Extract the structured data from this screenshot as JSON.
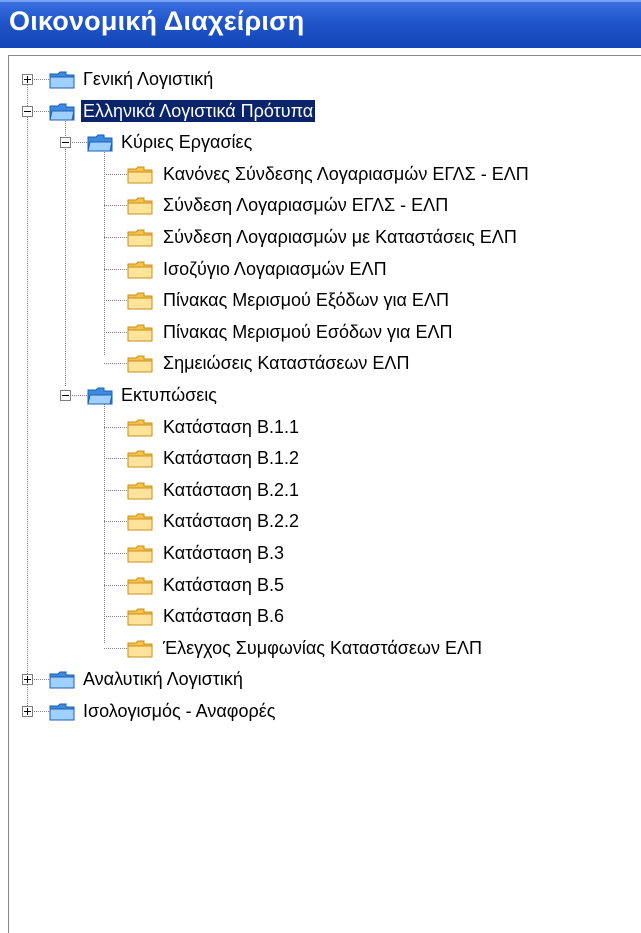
{
  "window": {
    "title": "Οικονομική Διαχείριση"
  },
  "colors": {
    "title_bar": "#1f54c8",
    "title_text": "#ffffff",
    "selection": "#0a246a",
    "folder_blue": "#3d8be0",
    "folder_yellow": "#f6c24a"
  },
  "tree": {
    "nodes": [
      {
        "id": "n0",
        "label": "Γενική Λογιστική",
        "level": 0,
        "expander": "plus",
        "icon": "folder-blue-icon",
        "selected": false
      },
      {
        "id": "n1",
        "label": "Ελληνικά Λογιστικά Πρότυπα",
        "level": 0,
        "expander": "minus",
        "icon": "folder-blue-open-icon",
        "selected": true
      },
      {
        "id": "n2",
        "label": "Κύριες Εργασίες",
        "level": 1,
        "expander": "minus",
        "icon": "folder-blue-open-icon",
        "selected": false
      },
      {
        "id": "n3",
        "label": "Κανόνες Σύνδεσης Λογαριασμών ΕΓΛΣ - ΕΛΠ",
        "level": 2,
        "expander": "none",
        "icon": "folder-yellow-icon",
        "selected": false
      },
      {
        "id": "n4",
        "label": "Σύνδεση Λογαριασμών ΕΓΛΣ - ΕΛΠ",
        "level": 2,
        "expander": "none",
        "icon": "folder-yellow-icon",
        "selected": false
      },
      {
        "id": "n5",
        "label": "Σύνδεση Λογαριασμών με Καταστάσεις ΕΛΠ",
        "level": 2,
        "expander": "none",
        "icon": "folder-yellow-icon",
        "selected": false
      },
      {
        "id": "n6",
        "label": "Ισοζύγιο Λογαριασμών ΕΛΠ",
        "level": 2,
        "expander": "none",
        "icon": "folder-yellow-icon",
        "selected": false
      },
      {
        "id": "n7",
        "label": "Πίνακας Μερισμού Εξόδων για ΕΛΠ",
        "level": 2,
        "expander": "none",
        "icon": "folder-yellow-icon",
        "selected": false
      },
      {
        "id": "n8",
        "label": "Πίνακας Μερισμού Εσόδων για ΕΛΠ",
        "level": 2,
        "expander": "none",
        "icon": "folder-yellow-icon",
        "selected": false
      },
      {
        "id": "n9",
        "label": "Σημειώσεις Καταστάσεων ΕΛΠ",
        "level": 2,
        "expander": "none",
        "icon": "folder-yellow-icon",
        "selected": false
      },
      {
        "id": "n10",
        "label": "Εκτυπώσεις",
        "level": 1,
        "expander": "minus",
        "icon": "folder-blue-open-icon",
        "selected": false
      },
      {
        "id": "n11",
        "label": "Κατάσταση Β.1.1",
        "level": 2,
        "expander": "none",
        "icon": "folder-yellow-icon",
        "selected": false
      },
      {
        "id": "n12",
        "label": "Κατάσταση Β.1.2",
        "level": 2,
        "expander": "none",
        "icon": "folder-yellow-icon",
        "selected": false
      },
      {
        "id": "n13",
        "label": "Κατάσταση Β.2.1",
        "level": 2,
        "expander": "none",
        "icon": "folder-yellow-icon",
        "selected": false
      },
      {
        "id": "n14",
        "label": "Κατάσταση Β.2.2",
        "level": 2,
        "expander": "none",
        "icon": "folder-yellow-icon",
        "selected": false
      },
      {
        "id": "n15",
        "label": "Κατάσταση Β.3",
        "level": 2,
        "expander": "none",
        "icon": "folder-yellow-icon",
        "selected": false
      },
      {
        "id": "n16",
        "label": "Κατάσταση Β.5",
        "level": 2,
        "expander": "none",
        "icon": "folder-yellow-icon",
        "selected": false
      },
      {
        "id": "n17",
        "label": "Κατάσταση Β.6",
        "level": 2,
        "expander": "none",
        "icon": "folder-yellow-icon",
        "selected": false
      },
      {
        "id": "n18",
        "label": "Έλεγχος Συμφωνίας Καταστάσεων ΕΛΠ",
        "level": 2,
        "expander": "none",
        "icon": "folder-yellow-icon",
        "selected": false
      },
      {
        "id": "n19",
        "label": "Αναλυτική Λογιστική",
        "level": 0,
        "expander": "plus",
        "icon": "folder-blue-icon",
        "selected": false
      },
      {
        "id": "n20",
        "label": "Ισολογισμός - Αναφορές",
        "level": 0,
        "expander": "plus",
        "icon": "folder-blue-icon",
        "selected": false
      }
    ]
  }
}
